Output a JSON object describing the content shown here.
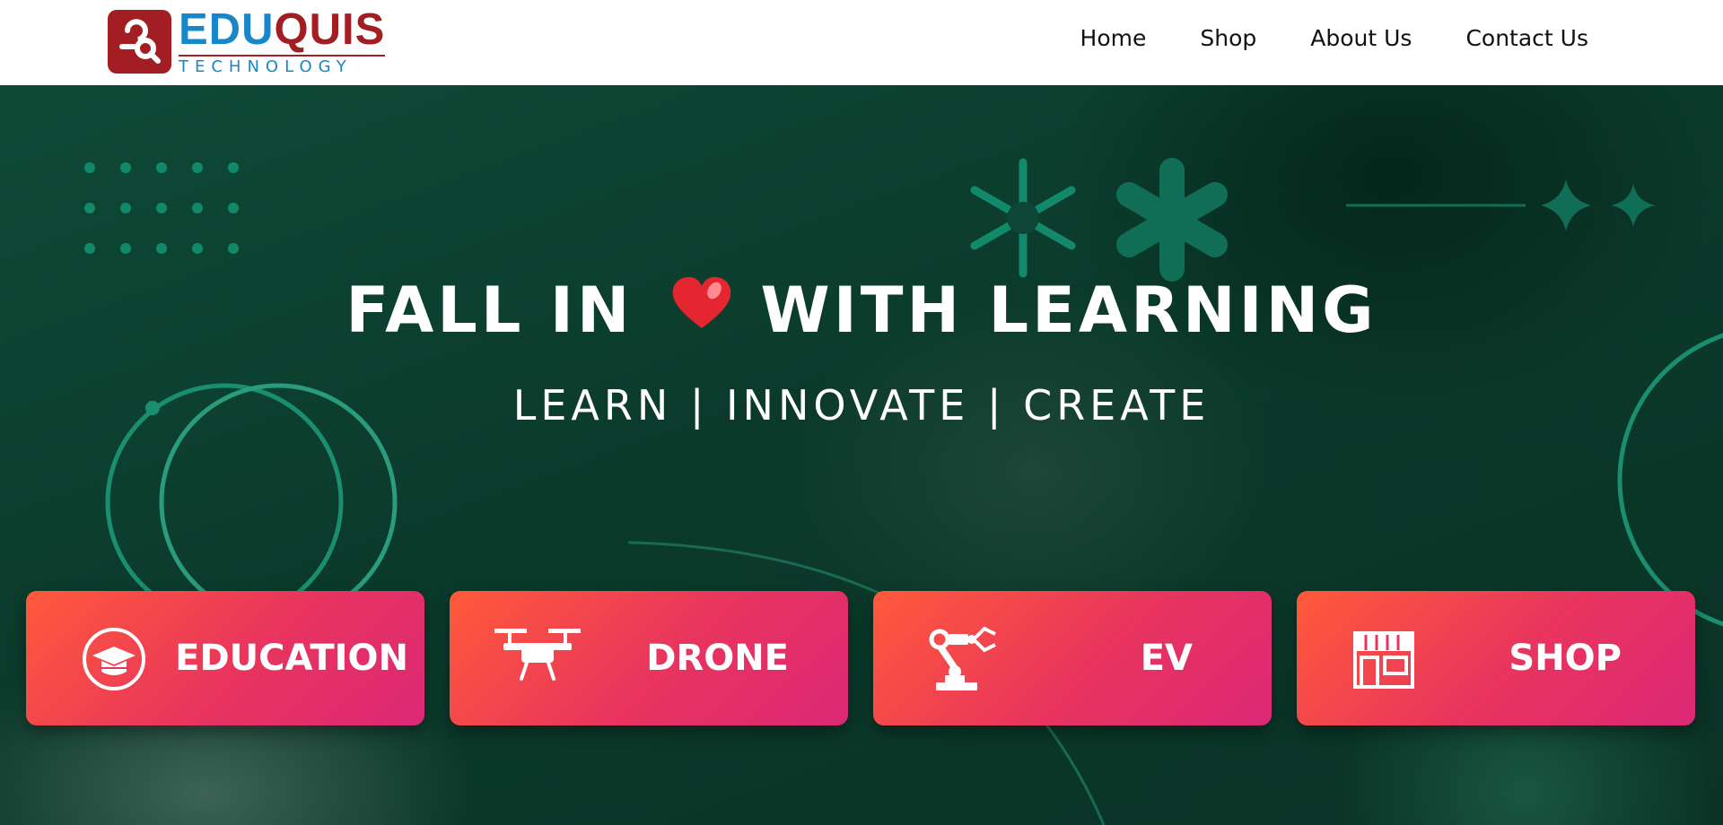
{
  "brand": {
    "name_part1": "EDU",
    "name_part2": "QUIS",
    "subtitle": "TECHNOLOGY"
  },
  "nav": {
    "items": [
      {
        "label": "Home"
      },
      {
        "label": "Shop"
      },
      {
        "label": "About Us"
      },
      {
        "label": "Contact Us"
      }
    ]
  },
  "hero": {
    "headline_part1": "FALL IN",
    "headline_part2": "WITH LEARNING",
    "heart_icon": "heart-icon",
    "tagline": "LEARN | INNOVATE | CREATE"
  },
  "cards": [
    {
      "label": "EDUCATION",
      "icon": "graduation-cap-icon"
    },
    {
      "label": "DRONE",
      "icon": "drone-icon"
    },
    {
      "label": "EV",
      "icon": "robotic-arm-icon"
    },
    {
      "label": "SHOP",
      "icon": "storefront-icon"
    }
  ],
  "colors": {
    "brand_red": "#a31e22",
    "brand_blue": "#1887c9",
    "hero_green": "#0b3a2b",
    "card_gradient_start": "#ff5a3a",
    "card_gradient_end": "#dc2876"
  }
}
